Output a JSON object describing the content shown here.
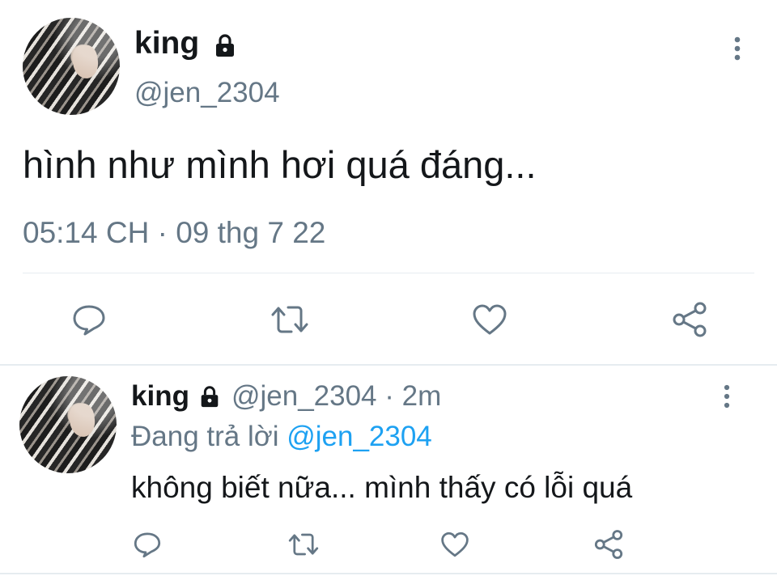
{
  "main_tweet": {
    "display_name": "king",
    "handle": "@jen_2304",
    "text": "hình như mình hơi quá đáng...",
    "timestamp": "05:14 CH · 09 thg 7 22"
  },
  "reply_tweet": {
    "display_name": "king",
    "handle_time": "@jen_2304 · 2m",
    "replying_prefix": "Đang trả lời",
    "replying_handle": "@jen_2304",
    "text": "không biết nữa... mình thấy có lỗi quá"
  },
  "icons": {
    "lock": "lock-icon",
    "more": "more-vertical-icon",
    "reply": "reply-icon",
    "retweet": "retweet-icon",
    "like": "heart-icon",
    "share": "share-icon"
  },
  "colors": {
    "text": "#14171a",
    "secondary": "#657786",
    "link": "#1da1f2",
    "icon": "#657786",
    "divider": "#e6ecf0"
  }
}
